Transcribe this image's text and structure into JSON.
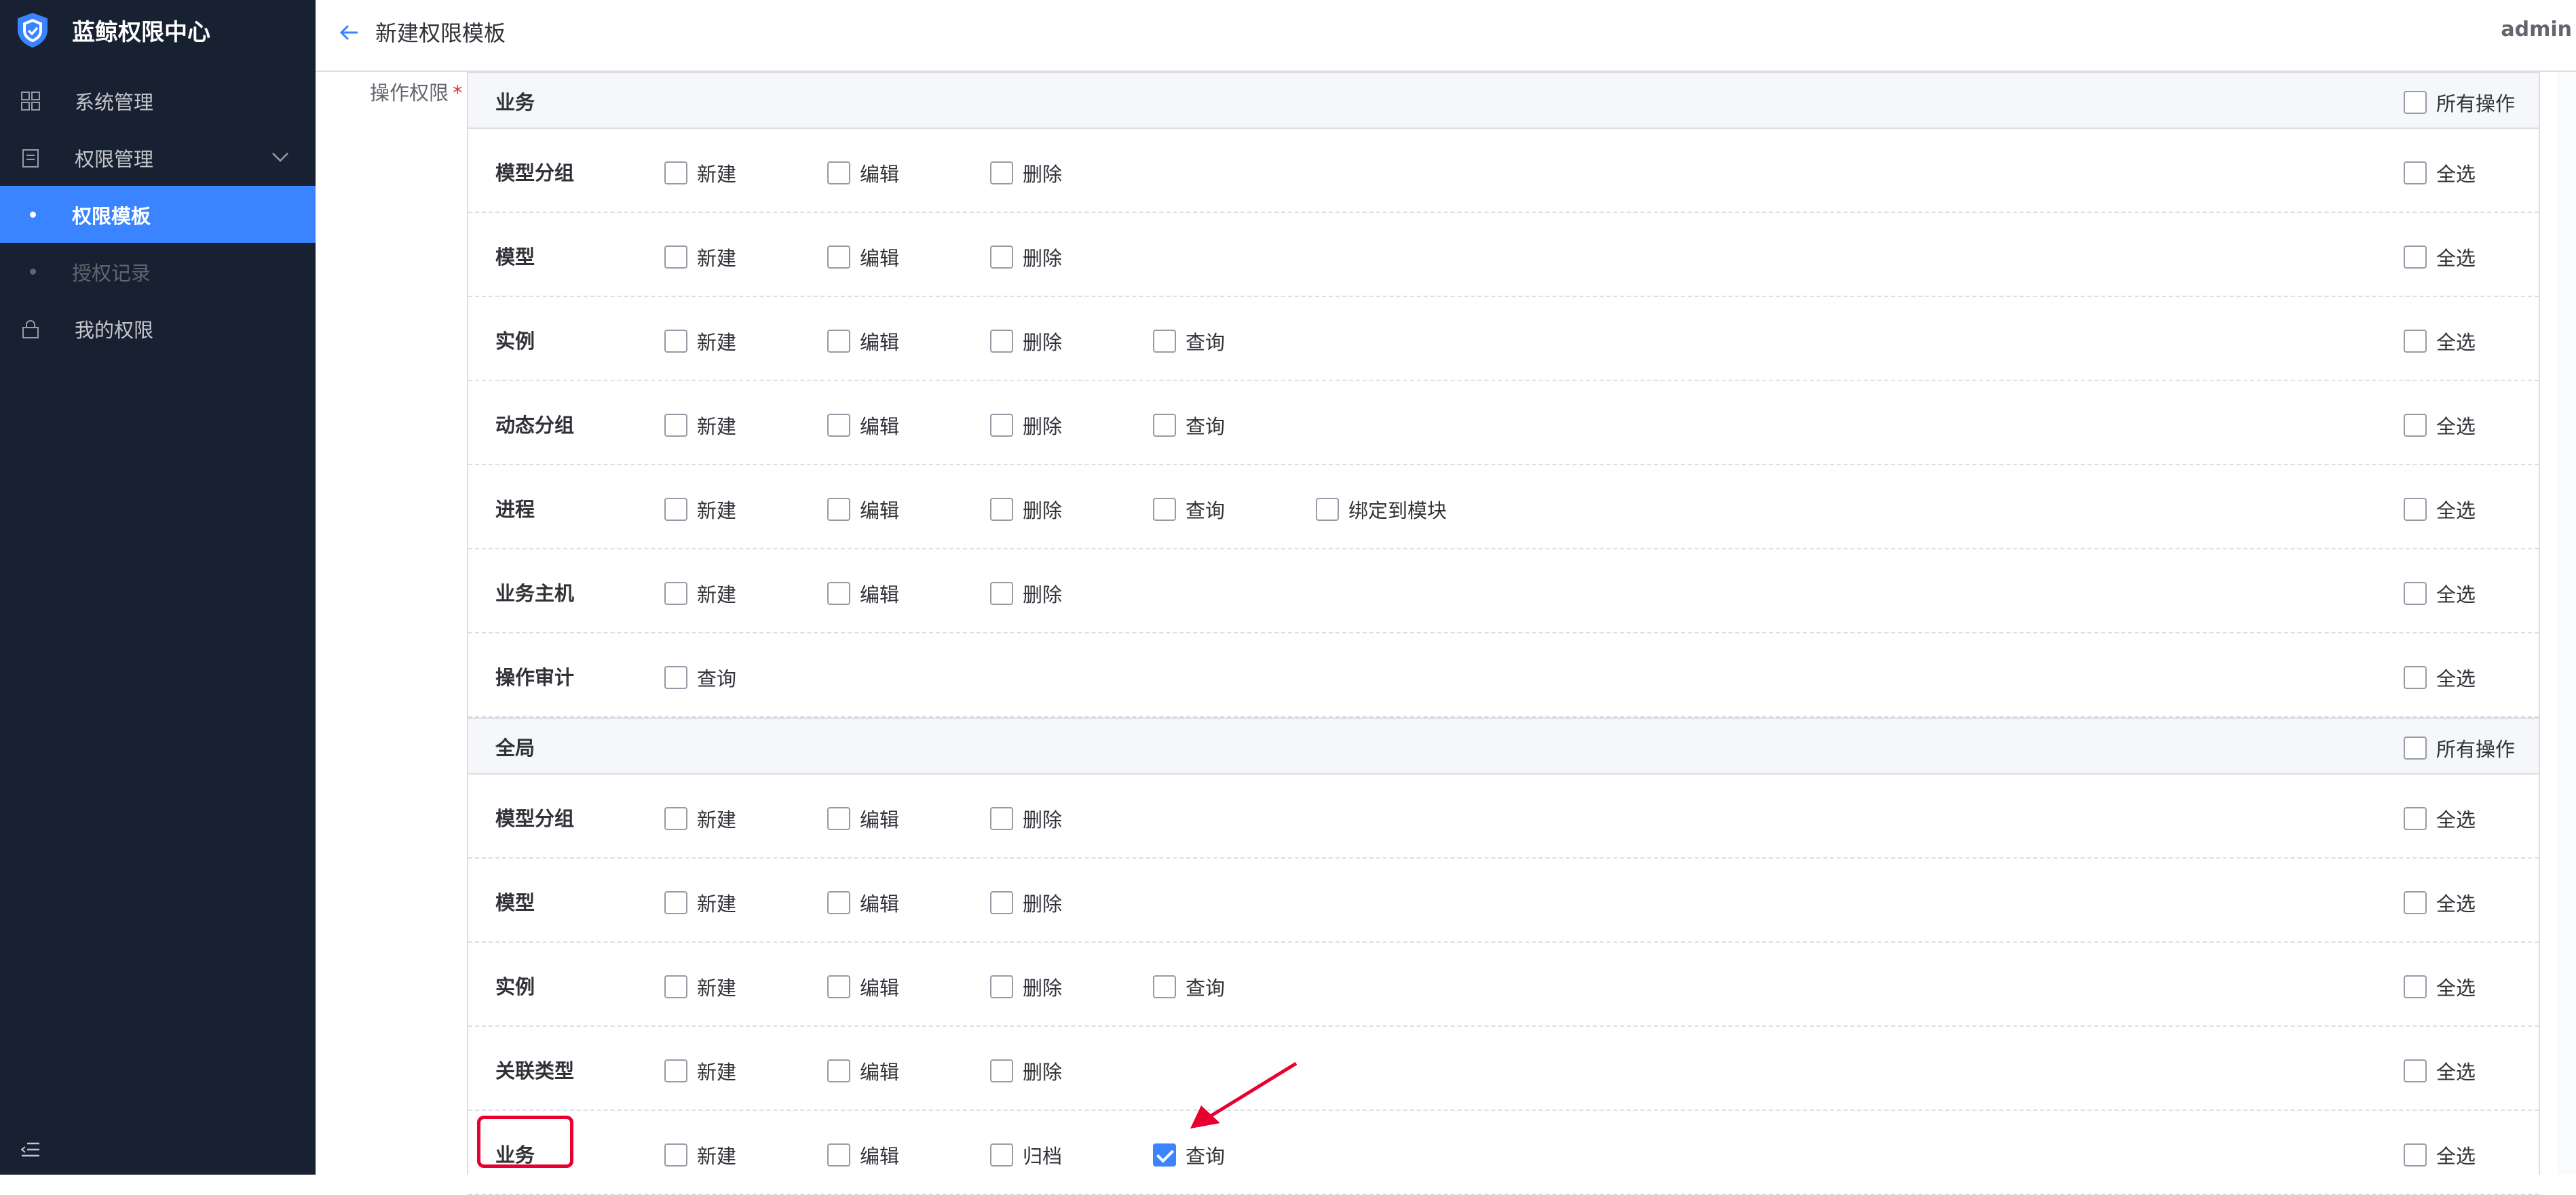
{
  "app": {
    "title": "蓝鲸权限中心",
    "user": "admin"
  },
  "sidebar": {
    "items": [
      {
        "label": "系统管理",
        "icon": "grid-icon"
      },
      {
        "label": "权限管理",
        "icon": "clipboard-icon"
      },
      {
        "label": "权限模板",
        "active": true
      },
      {
        "label": "授权记录"
      },
      {
        "label": "我的权限",
        "icon": "lock-icon"
      }
    ]
  },
  "header": {
    "title": "新建权限模板"
  },
  "form": {
    "label": "操作权限",
    "required_mark": "*",
    "all_label": "所有操作",
    "select_all_label": "全选",
    "groups": [
      {
        "name": "业务",
        "rows": [
          {
            "name": "模型分组",
            "actions": [
              {
                "label": "新建",
                "checked": false
              },
              {
                "label": "编辑",
                "checked": false
              },
              {
                "label": "删除",
                "checked": false
              }
            ]
          },
          {
            "name": "模型",
            "actions": [
              {
                "label": "新建",
                "checked": false
              },
              {
                "label": "编辑",
                "checked": false
              },
              {
                "label": "删除",
                "checked": false
              }
            ]
          },
          {
            "name": "实例",
            "actions": [
              {
                "label": "新建",
                "checked": false
              },
              {
                "label": "编辑",
                "checked": false
              },
              {
                "label": "删除",
                "checked": false
              },
              {
                "label": "查询",
                "checked": false
              }
            ]
          },
          {
            "name": "动态分组",
            "actions": [
              {
                "label": "新建",
                "checked": false
              },
              {
                "label": "编辑",
                "checked": false
              },
              {
                "label": "删除",
                "checked": false
              },
              {
                "label": "查询",
                "checked": false
              }
            ]
          },
          {
            "name": "进程",
            "actions": [
              {
                "label": "新建",
                "checked": false
              },
              {
                "label": "编辑",
                "checked": false
              },
              {
                "label": "删除",
                "checked": false
              },
              {
                "label": "查询",
                "checked": false
              },
              {
                "label": "绑定到模块",
                "checked": false
              }
            ]
          },
          {
            "name": "业务主机",
            "actions": [
              {
                "label": "新建",
                "checked": false
              },
              {
                "label": "编辑",
                "checked": false
              },
              {
                "label": "删除",
                "checked": false
              }
            ]
          },
          {
            "name": "操作审计",
            "actions": [
              {
                "label": "查询",
                "checked": false
              }
            ]
          }
        ]
      },
      {
        "name": "全局",
        "rows": [
          {
            "name": "模型分组",
            "actions": [
              {
                "label": "新建",
                "checked": false
              },
              {
                "label": "编辑",
                "checked": false
              },
              {
                "label": "删除",
                "checked": false
              }
            ]
          },
          {
            "name": "模型",
            "actions": [
              {
                "label": "新建",
                "checked": false
              },
              {
                "label": "编辑",
                "checked": false
              },
              {
                "label": "删除",
                "checked": false
              }
            ]
          },
          {
            "name": "实例",
            "actions": [
              {
                "label": "新建",
                "checked": false
              },
              {
                "label": "编辑",
                "checked": false
              },
              {
                "label": "删除",
                "checked": false
              },
              {
                "label": "查询",
                "checked": false
              }
            ]
          },
          {
            "name": "关联类型",
            "actions": [
              {
                "label": "新建",
                "checked": false
              },
              {
                "label": "编辑",
                "checked": false
              },
              {
                "label": "删除",
                "checked": false
              }
            ]
          },
          {
            "name": "业务",
            "actions": [
              {
                "label": "新建",
                "checked": false
              },
              {
                "label": "编辑",
                "checked": false
              },
              {
                "label": "归档",
                "checked": false
              },
              {
                "label": "查询",
                "checked": true
              }
            ]
          }
        ]
      }
    ]
  },
  "colors": {
    "sidebar_bg": "#182132",
    "accent": "#3a84ff",
    "annotation": "#e8002e"
  }
}
